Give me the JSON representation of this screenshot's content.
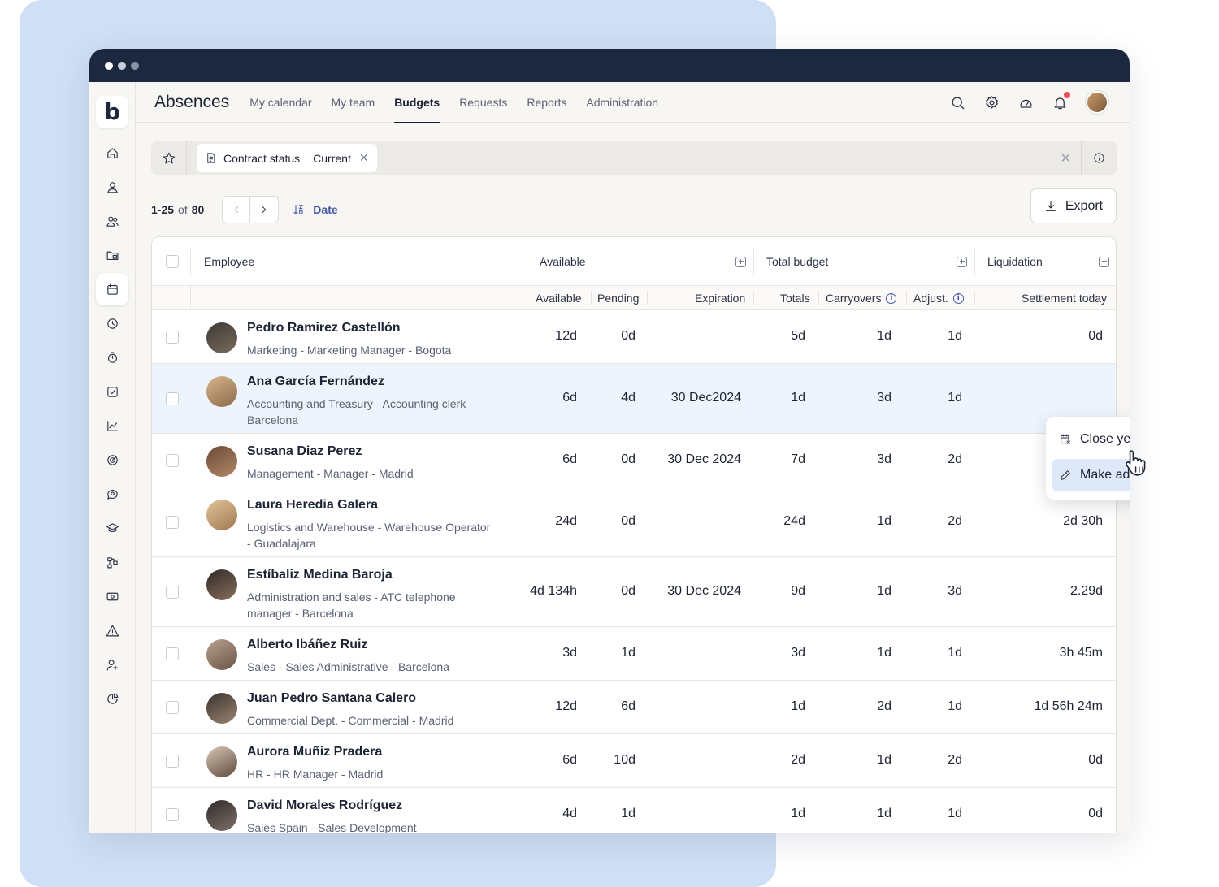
{
  "app": {
    "title": "Absences"
  },
  "nav": {
    "tabs": [
      {
        "label": "My calendar"
      },
      {
        "label": "My team"
      },
      {
        "label": "Budgets",
        "active": true
      },
      {
        "label": "Requests"
      },
      {
        "label": "Reports"
      },
      {
        "label": "Administration"
      }
    ]
  },
  "logo": {
    "text": "b"
  },
  "filter": {
    "chip_key": "Contract status",
    "chip_value": "Current"
  },
  "pager": {
    "range": "1-25",
    "of": "of",
    "total": "80"
  },
  "sort": {
    "label": "Date"
  },
  "export": {
    "label": "Export"
  },
  "table": {
    "groups": {
      "employee": "Employee",
      "available": "Available",
      "total_budget": "Total budget",
      "liquidation": "Liquidation"
    },
    "subcols": {
      "available": "Available",
      "pending": "Pending",
      "expiration": "Expiration",
      "totals": "Totals",
      "carryovers": "Carryovers",
      "adjust": "Adjust.",
      "settlement": "Settlement today"
    },
    "rows": [
      {
        "name": "Pedro Ramirez Castellón",
        "sub": "Marketing - Marketing Manager - Bogota",
        "available": "12d",
        "pending": "0d",
        "expiration": "",
        "totals": "5d",
        "carryovers": "1d",
        "adjust": "1d",
        "settlement": "0d"
      },
      {
        "name": "Ana García Fernández",
        "sub": "Accounting and Treasury - Accounting clerk - Barcelona",
        "available": "6d",
        "pending": "4d",
        "expiration": "30 Dec2024",
        "totals": "1d",
        "carryovers": "3d",
        "adjust": "1d",
        "settlement": ""
      },
      {
        "name": "Susana Diaz Perez",
        "sub": "Management - Manager - Madrid",
        "available": "6d",
        "pending": "0d",
        "expiration": "30 Dec 2024",
        "totals": "7d",
        "carryovers": "3d",
        "adjust": "2d",
        "settlement": ""
      },
      {
        "name": "Laura Heredia Galera",
        "sub": "Logistics and Warehouse - Warehouse Operator - Guadalajara",
        "available": "24d",
        "pending": "0d",
        "expiration": "",
        "totals": "24d",
        "carryovers": "1d",
        "adjust": "2d",
        "settlement": "2d 30h"
      },
      {
        "name": "Estíbaliz Medina Baroja",
        "sub": "Administration and sales - ATC telephone manager - Barcelona",
        "available": "4d 134h",
        "pending": "0d",
        "expiration": "30 Dec 2024",
        "totals": "9d",
        "carryovers": "1d",
        "adjust": "3d",
        "settlement": "2.29d"
      },
      {
        "name": "Alberto Ibáñez Ruiz",
        "sub": "Sales - Sales Administrative - Barcelona",
        "available": "3d",
        "pending": "1d",
        "expiration": "",
        "totals": "3d",
        "carryovers": "1d",
        "adjust": "1d",
        "settlement": "3h 45m"
      },
      {
        "name": "Juan Pedro Santana Calero",
        "sub": "Commercial Dept. - Commercial - Madrid",
        "available": "12d",
        "pending": "6d",
        "expiration": "",
        "totals": "1d",
        "carryovers": "2d",
        "adjust": "1d",
        "settlement": "1d 56h 24m"
      },
      {
        "name": "Aurora Muñiz Pradera",
        "sub": "HR - HR Manager - Madrid",
        "available": "6d",
        "pending": "10d",
        "expiration": "",
        "totals": "2d",
        "carryovers": "1d",
        "adjust": "2d",
        "settlement": "0d"
      },
      {
        "name": "David Morales Rodríguez",
        "sub": "Sales Spain - Sales Development",
        "available": "4d",
        "pending": "1d",
        "expiration": "",
        "totals": "1d",
        "carryovers": "1d",
        "adjust": "1d",
        "settlement": "0d"
      }
    ]
  },
  "context_menu": {
    "items": [
      {
        "label": "Close year"
      },
      {
        "label": "Make adjustment",
        "active": true
      }
    ]
  },
  "colors": {
    "accent": "#4356a6",
    "titlebar": "#1c2740",
    "highlight_row": "#eef4fc",
    "background_panel": "#cfdff5",
    "notification": "#ef4e5a"
  }
}
